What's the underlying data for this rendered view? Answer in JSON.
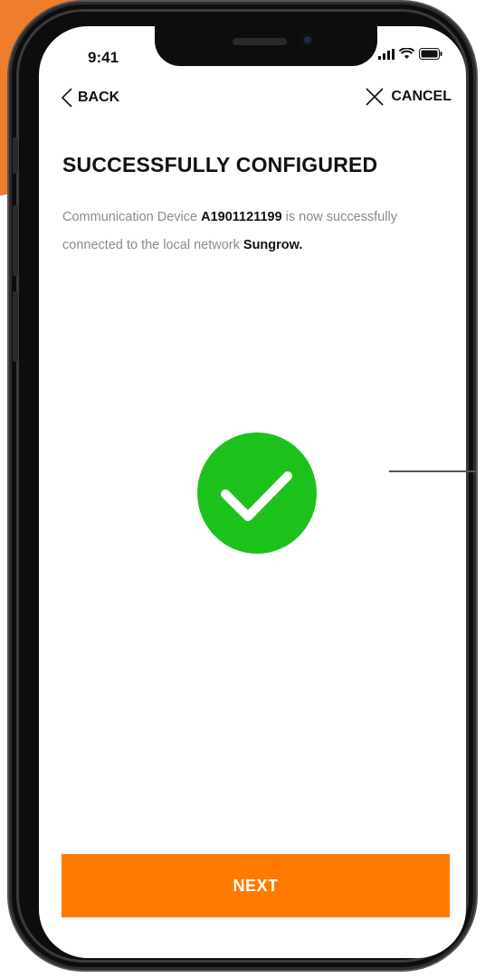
{
  "status_bar": {
    "time": "9:41",
    "icons": [
      "signal-icon",
      "wifi-icon",
      "battery-icon"
    ]
  },
  "nav": {
    "back_label": "BACK",
    "cancel_label": "CANCEL"
  },
  "main": {
    "title": "SUCCESSFULLY CONFIGURED",
    "desc_part1": "Communication Device ",
    "device_id": "A1901121199",
    "desc_part2": " is now successfully connected to the local network ",
    "network_name": "Sungrow."
  },
  "status_icon": {
    "name": "check-circle-icon",
    "color": "#1dc11c"
  },
  "footer": {
    "next_label": "NEXT"
  },
  "colors": {
    "accent": "#ff7a00",
    "success": "#1dc11c",
    "background_accent": "#f07d2c"
  }
}
